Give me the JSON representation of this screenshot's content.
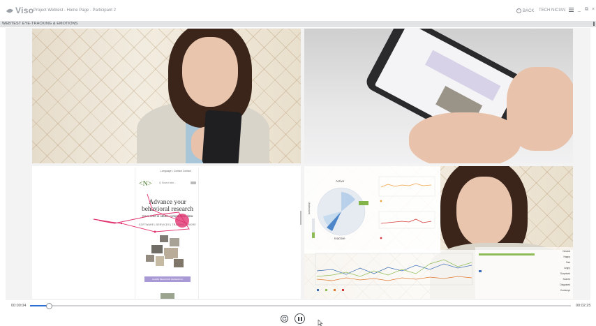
{
  "app": {
    "name": "Viso",
    "project_title": "Project Webtest - Home Page - Participant 2"
  },
  "header": {
    "back_label": "BACK",
    "user_name": "TECH NICIAN",
    "minimize": "_",
    "maximize": "⧉",
    "close": "×"
  },
  "section": {
    "title": "WEBTEST EYE-TRACKING & EMOTIONS"
  },
  "mobile_page": {
    "nav": "Language •   Contact   Contact",
    "logo": "<N>",
    "search": "Q  Search site...",
    "headline": "Advance your behavioral research",
    "subtext": "Save time & obtain comparable data",
    "links": "SOFTWARE  |  SERVICES  |  TRAINING & MORE",
    "cta": "LEARN BEHAVIOR RESEARCH"
  },
  "dashboard": {
    "active_label": "Active",
    "inactive_label": "Inactive",
    "axis_label": "Unpleasant"
  },
  "emotions": [
    "Neutral",
    "Happy",
    "Sad",
    "Angry",
    "Surprised",
    "Scared",
    "Disgusted",
    "Contempt"
  ],
  "playback": {
    "current_time": "00:00:04",
    "total_time": "00:02:25",
    "progress": 0.035
  },
  "colors": {
    "progress": "#2b6fd6",
    "gaze": "#e0306e",
    "section_bg": "#e2e3e5"
  }
}
